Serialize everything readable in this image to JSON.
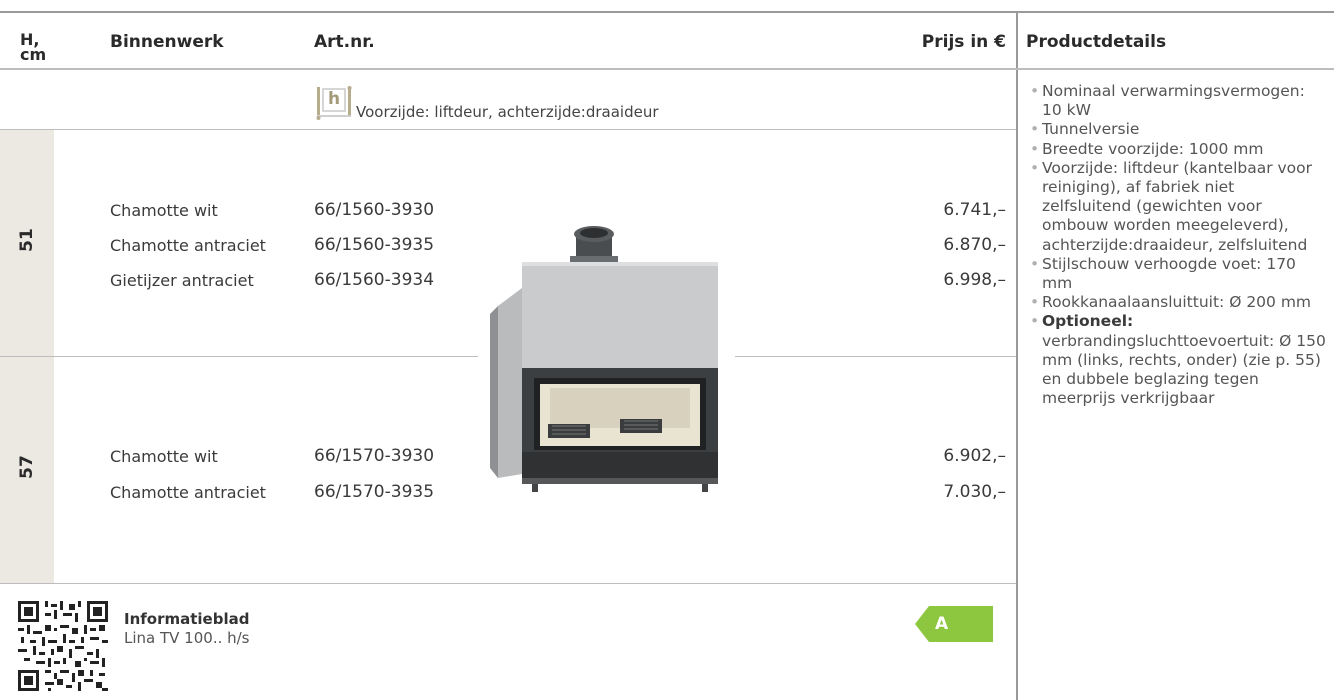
{
  "header": {
    "col_h": "H,\ncm",
    "col_binnenwerk": "Binnenwerk",
    "col_artnr": "Art.nr.",
    "col_prijs": "Prijs in €",
    "col_details": "Productdetails"
  },
  "door_info": {
    "icon_letter": "h",
    "text": "Voorzijde: liftdeur, achterzijde:draaideur"
  },
  "groups": [
    {
      "height": "51",
      "rows": [
        {
          "binnenwerk": "Chamotte wit",
          "artnr": "66/1560-3930",
          "prijs": "6.741,–"
        },
        {
          "binnenwerk": "Chamotte antraciet",
          "artnr": "66/1560-3935",
          "prijs": "6.870,–"
        },
        {
          "binnenwerk": "Gietijzer antraciet",
          "artnr": "66/1560-3934",
          "prijs": "6.998,–"
        }
      ]
    },
    {
      "height": "57",
      "rows": [
        {
          "binnenwerk": "Chamotte wit",
          "artnr": "66/1570-3930",
          "prijs": "6.902,–"
        },
        {
          "binnenwerk": "Chamotte antraciet",
          "artnr": "66/1570-3935",
          "prijs": "7.030,–"
        }
      ]
    }
  ],
  "details": [
    "Nominaal verwarmingsvermogen: 10 kW",
    "Tunnelversie",
    "Breedte voorzijde: 1000 mm",
    "Voorzijde: liftdeur (kantelbaar voor reiniging), af fabriek niet zelfsluitend (gewichten voor ombouw worden meegeleverd), achterzijde:draaideur, zelfsluitend",
    "Stijlschouw verhoogde voet: 170 mm",
    "Rookkanaalaansluittuit: Ø 200 mm"
  ],
  "optional": {
    "label": "Optioneel:",
    "text": "verbrandingsluchttoevoertuit: Ø 150 mm (links, rechts, onder) (zie p. 55) en dubbele beglazing tegen meerprijs verkrijgbaar"
  },
  "footer": {
    "info_title": "Informatieblad",
    "info_sub": "Lina TV 100.. h/s",
    "energy_label": "A"
  },
  "colors": {
    "band": "#ece9e3",
    "energy_green": "#8dc63f",
    "rule": "#9a9a9a"
  }
}
